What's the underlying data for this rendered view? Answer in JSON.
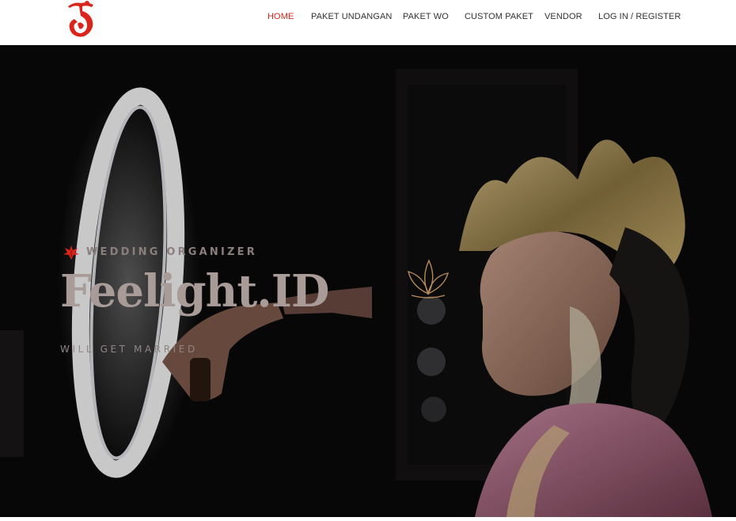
{
  "brand": {
    "logo_icon": "feelight-rooster-logo-icon",
    "accent_color": "#d9251c"
  },
  "nav": {
    "items": [
      {
        "label": "HOME",
        "active": true
      },
      {
        "label": "PAKET UNDANGAN",
        "active": false
      },
      {
        "label": "PAKET WO",
        "active": false
      },
      {
        "label": "CUSTOM PAKET",
        "active": false
      },
      {
        "label": "VENDOR",
        "active": false
      },
      {
        "label": "LOG IN / REGISTER",
        "active": false
      }
    ]
  },
  "hero": {
    "eyebrow_icon": "red-leaf-icon",
    "eyebrow": "WEDDING ORGANIZER",
    "title": "Feelight.ID",
    "subtitle": "WILL GET MARRIED",
    "ornament_icon": "lotus-flower-icon",
    "background_image": "bride-makeup-ring-light-photo"
  }
}
